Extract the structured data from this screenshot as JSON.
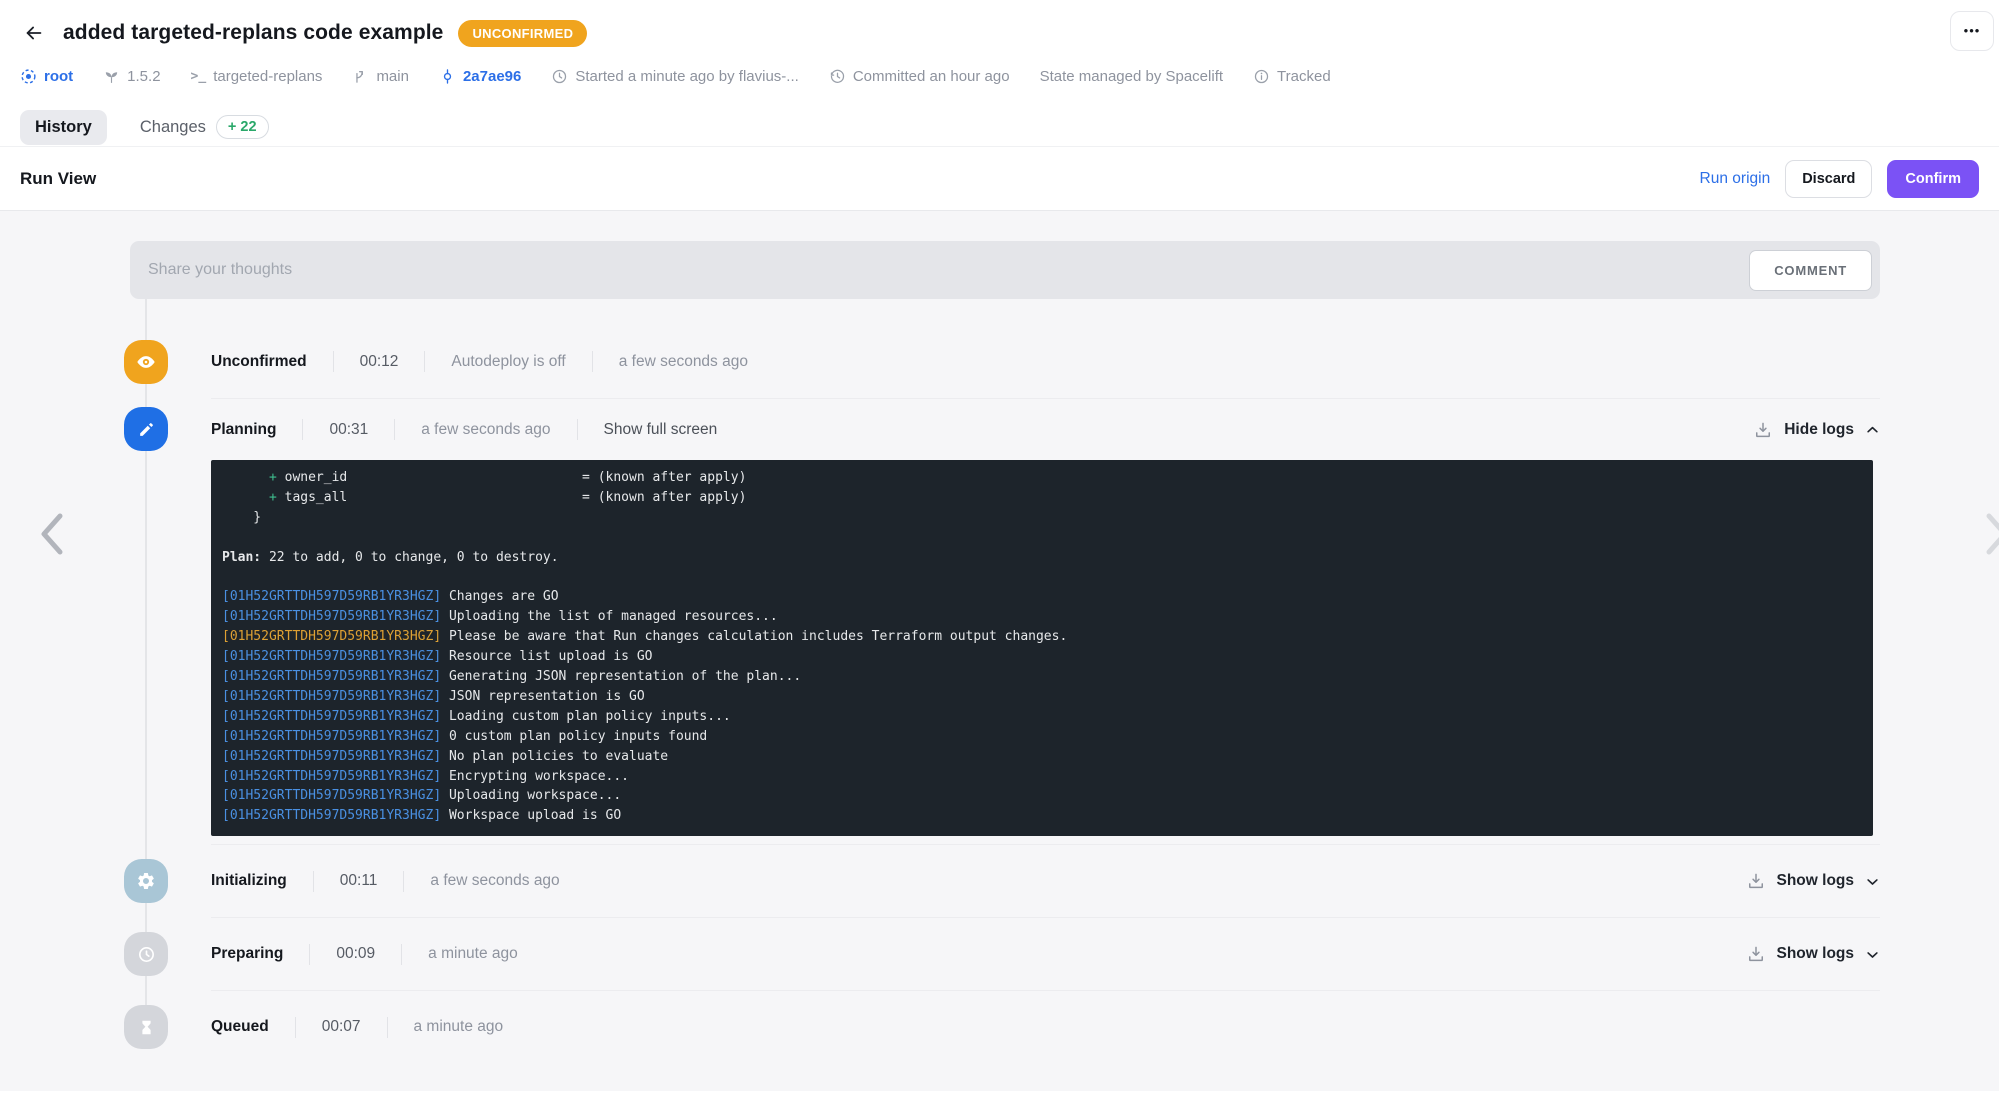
{
  "colors": {
    "badge_orange": "#f0a41e",
    "accent_purple": "#7b52f5",
    "link_blue": "#2c6fe7",
    "green": "#2aa86a",
    "planning_blue": "#1f6fe5",
    "init_circle": "#a9c6d6",
    "pending_circle": "#d4d6db",
    "term_bg": "#1d242b",
    "term_fg": "#e6e8ea",
    "term_blue": "#4a90e2",
    "term_orange": "#dfa032",
    "term_green": "#3fbf8f"
  },
  "header": {
    "title": "added targeted-replans code example",
    "status_badge": "UNCONFIRMED",
    "more_label": "•••",
    "meta": [
      {
        "icon": "stack-icon",
        "label": "root"
      },
      {
        "icon": "terraform-version-icon",
        "label": "1.5.2"
      },
      {
        "icon": "terminal-icon",
        "label": "targeted-replans"
      },
      {
        "icon": "branch-icon",
        "label": "main"
      },
      {
        "icon": "commit-icon",
        "label": "2a7ae96"
      },
      {
        "icon": "clock-icon",
        "label": "Started a minute ago by flavius-..."
      },
      {
        "icon": "history-clock-icon",
        "label": "Committed an hour ago"
      },
      {
        "icon": null,
        "label": "State managed by Spacelift"
      },
      {
        "icon": "info-icon",
        "label": "Tracked"
      }
    ],
    "tabs": {
      "history": "History",
      "changes": "Changes",
      "changes_badge": "+ 22"
    }
  },
  "run_view": {
    "title": "Run View",
    "run_origin_label": "Run origin",
    "discard_label": "Discard",
    "confirm_label": "Confirm"
  },
  "comment": {
    "placeholder": "Share your thoughts",
    "button_label": "COMMENT"
  },
  "timeline": {
    "entries": [
      {
        "label": "Unconfirmed",
        "duration": "00:12",
        "note": "Autodeploy is off",
        "time": "a few seconds ago"
      },
      {
        "label": "Planning",
        "duration": "00:31",
        "time": "a few seconds ago",
        "action": "Show full screen",
        "logs_toggle": "Hide logs"
      },
      {
        "label": "Initializing",
        "duration": "00:11",
        "time": "a few seconds ago",
        "logs_toggle": "Show logs"
      },
      {
        "label": "Preparing",
        "duration": "00:09",
        "time": "a minute ago",
        "logs_toggle": "Show logs"
      },
      {
        "label": "Queued",
        "duration": "00:07",
        "time": "a minute ago"
      }
    ]
  },
  "terminal": {
    "log_id": "[01H52GRTTDH597D59RB1YR3HGZ]",
    "plan_lines": [
      [
        {
          "t": "      "
        },
        {
          "t": "+",
          "c": "g"
        },
        {
          "t": " owner_id                              = (known after apply)"
        }
      ],
      [
        {
          "t": "      "
        },
        {
          "t": "+",
          "c": "g"
        },
        {
          "t": " tags_all                              = (known after apply)"
        }
      ],
      [
        {
          "t": "    }"
        }
      ],
      [
        {
          "t": ""
        }
      ],
      [
        {
          "t": "Plan:",
          "c": "b"
        },
        {
          "t": " 22 to add, 0 to change, 0 to destroy."
        }
      ],
      [
        {
          "t": ""
        }
      ]
    ],
    "log_lines": [
      {
        "color": "blue",
        "text": "Changes are GO"
      },
      {
        "color": "blue",
        "text": "Uploading the list of managed resources..."
      },
      {
        "color": "orange",
        "text": "Please be aware that Run changes calculation includes Terraform output changes."
      },
      {
        "color": "blue",
        "text": "Resource list upload is GO"
      },
      {
        "color": "blue",
        "text": "Generating JSON representation of the plan..."
      },
      {
        "color": "blue",
        "text": "JSON representation is GO"
      },
      {
        "color": "blue",
        "text": "Loading custom plan policy inputs..."
      },
      {
        "color": "blue",
        "text": "0 custom plan policy inputs found"
      },
      {
        "color": "blue",
        "text": "No plan policies to evaluate"
      },
      {
        "color": "blue",
        "text": "Encrypting workspace..."
      },
      {
        "color": "blue",
        "text": "Uploading workspace..."
      },
      {
        "color": "blue",
        "text": "Workspace upload is GO"
      }
    ]
  }
}
